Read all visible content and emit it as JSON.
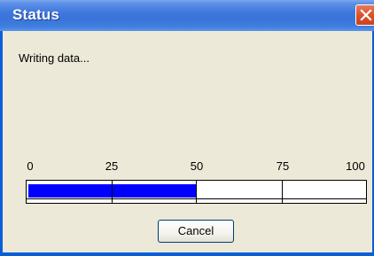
{
  "window": {
    "title": "Status"
  },
  "status_text": "Writing data...",
  "progress": {
    "value_percent": 50,
    "scale_labels": [
      "0",
      "25",
      "50",
      "75",
      "100"
    ],
    "fill_color": "#0000ff"
  },
  "buttons": {
    "cancel_label": "Cancel",
    "close_icon": "close-icon"
  }
}
